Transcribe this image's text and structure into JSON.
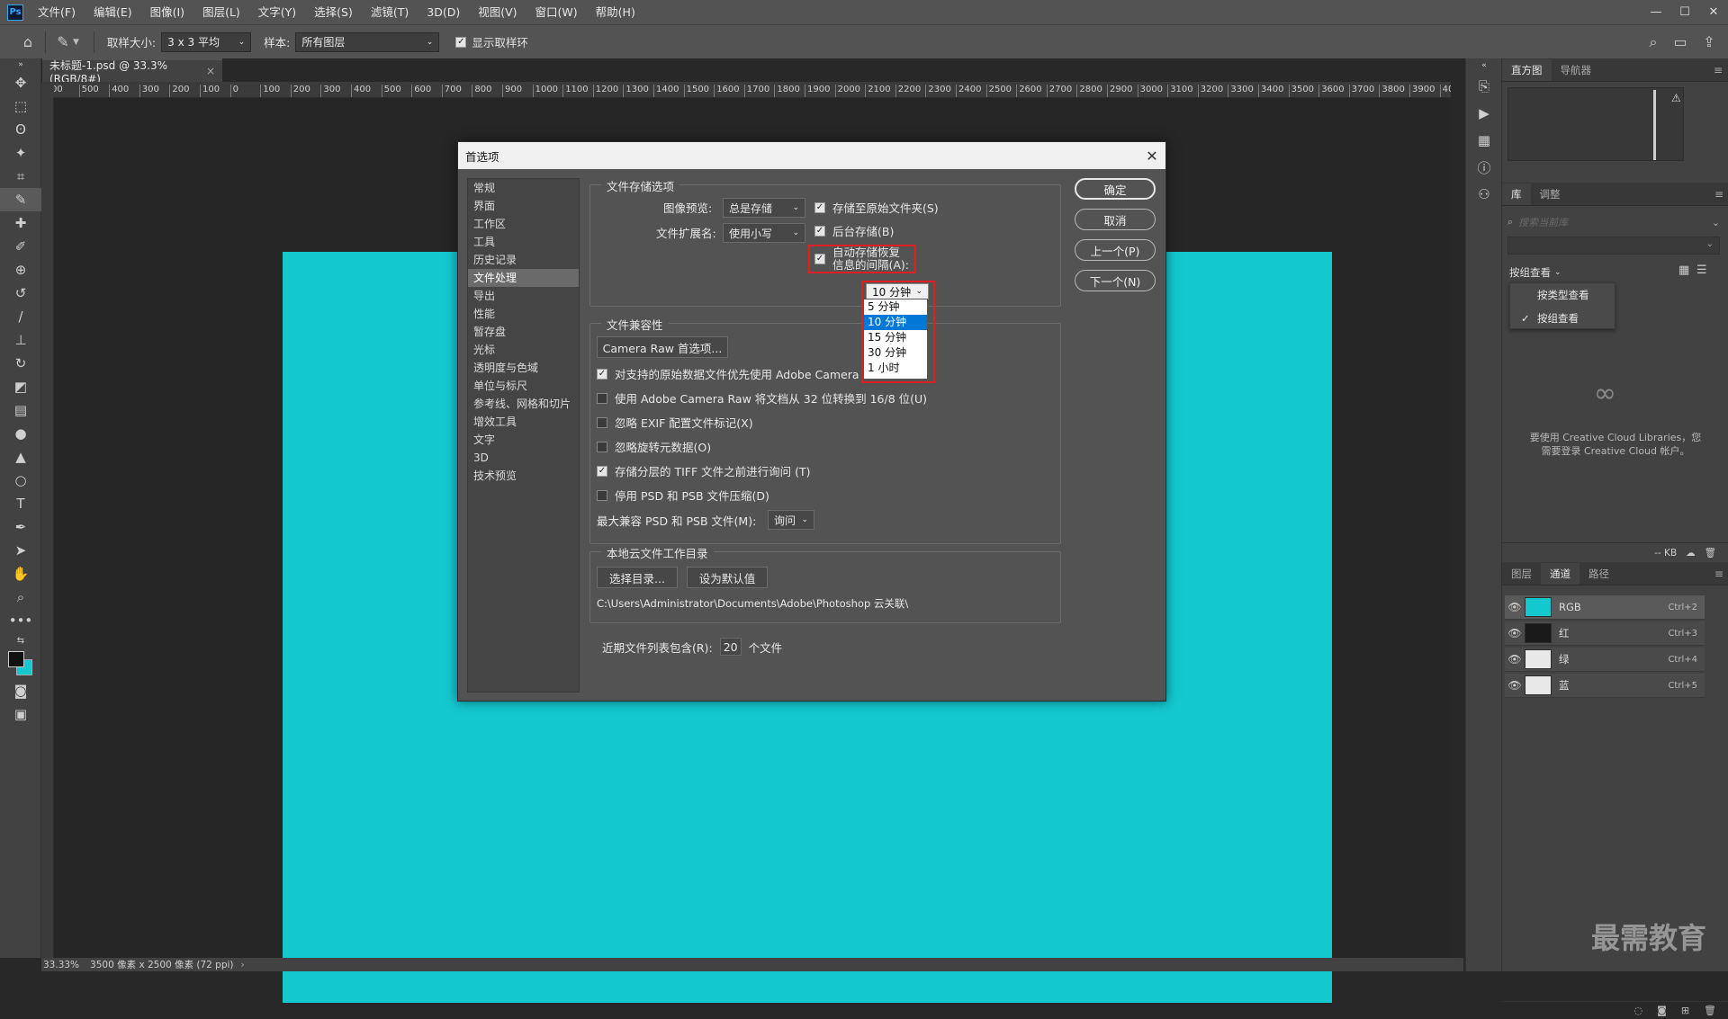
{
  "menubar": {
    "items": [
      "文件(F)",
      "编辑(E)",
      "图像(I)",
      "图层(L)",
      "文字(Y)",
      "选择(S)",
      "滤镜(T)",
      "3D(D)",
      "视图(V)",
      "窗口(W)",
      "帮助(H)"
    ]
  },
  "options": {
    "sample_size_label": "取样大小:",
    "sample_size_value": "3 x 3 平均",
    "sample_label": "样本:",
    "sample_value": "所有图层",
    "show_ring_label": "显示取样环"
  },
  "document": {
    "tab_title": "未标题-1.psd @ 33.3%(RGB/8#)",
    "zoom": "33.33%",
    "size_info": "3500 像素 x 2500 像素 (72 ppi)",
    "canvas_color": "#14c8d0"
  },
  "ruler_labels": [
    "00",
    "500",
    "400",
    "300",
    "200",
    "100",
    "0",
    "100",
    "200",
    "300",
    "400",
    "500",
    "600",
    "700",
    "800",
    "900",
    "1000",
    "1100",
    "1200",
    "1300",
    "1400",
    "1500",
    "1600",
    "1700",
    "1800",
    "1900",
    "2000",
    "2100",
    "2200",
    "2300",
    "2400",
    "2500",
    "2600",
    "2700",
    "2800",
    "2900",
    "3000",
    "3100",
    "3200",
    "3300",
    "3400",
    "3500",
    "3600",
    "3700",
    "3800",
    "3900",
    "4000"
  ],
  "panels": {
    "top_tabs": [
      "直方图",
      "导航器"
    ],
    "lib_tabs": [
      "库",
      "调整"
    ],
    "search_placeholder": "搜索当前库",
    "view_label": "按组查看",
    "view_menu": [
      "按类型查看",
      "按组查看"
    ],
    "cc_message_1": "要使用 Creative Cloud Libraries，您",
    "cc_message_2": "需要登录 Creative Cloud 帐户。",
    "kb": "-- KB",
    "layer_tabs": [
      "图层",
      "通道",
      "路径"
    ],
    "channels": [
      {
        "name": "RGB",
        "shortcut": "Ctrl+2",
        "color": "#14c8d0"
      },
      {
        "name": "红",
        "shortcut": "Ctrl+3",
        "color": "#1a1a1a"
      },
      {
        "name": "绿",
        "shortcut": "Ctrl+4",
        "color": "#e8e8e8"
      },
      {
        "name": "蓝",
        "shortcut": "Ctrl+5",
        "color": "#e8e8e8"
      }
    ]
  },
  "dialog": {
    "title": "首选项",
    "nav": [
      "常规",
      "界面",
      "工作区",
      "工具",
      "历史记录",
      "文件处理",
      "导出",
      "性能",
      "暂存盘",
      "光标",
      "透明度与色域",
      "单位与标尺",
      "参考线、网格和切片",
      "增效工具",
      "文字",
      "3D",
      "技术预览"
    ],
    "selected_nav": "文件处理",
    "buttons": {
      "ok": "确定",
      "cancel": "取消",
      "prev": "上一个(P)",
      "next": "下一个(N)"
    },
    "save_group": {
      "title": "文件存储选项",
      "image_preview_label": "图像预览:",
      "image_preview_value": "总是存储",
      "extension_label": "文件扩展名:",
      "extension_value": "使用小写",
      "save_to_original": "存储至原始文件夹(S)",
      "background_save": "后台存储(B)",
      "auto_save_line1": "自动存储恢复",
      "auto_save_line2": "信息的间隔(A):",
      "interval_value": "10 分钟",
      "interval_options": [
        "5 分钟",
        "10 分钟",
        "15 分钟",
        "30 分钟",
        "1 小时"
      ]
    },
    "compat_group": {
      "title": "文件兼容性",
      "camera_raw_button": "Camera Raw 首选项...",
      "opt1": "对支持的原始数据文件优先使用 Adobe Camera",
      "opt2": "使用 Adobe Camera Raw 将文档从 32 位转换到 16/8 位(U)",
      "opt3": "忽略 EXIF 配置文件标记(X)",
      "opt4": "忽略旋转元数据(O)",
      "opt5": "存储分层的 TIFF 文件之前进行询问 (T)",
      "opt6": "停用 PSD 和 PSB 文件压缩(D)",
      "max_compat_label": "最大兼容 PSD 和 PSB 文件(M):",
      "max_compat_value": "询问"
    },
    "cloud_group": {
      "title": "本地云文件工作目录",
      "choose_button": "选择目录...",
      "default_button": "设为默认值",
      "path": "C:\\Users\\Administrator\\Documents\\Adobe\\Photoshop 云关联\\"
    },
    "recent_label": "近期文件列表包含(R):",
    "recent_value": "20",
    "recent_unit": "个文件"
  },
  "watermark": "最需教育"
}
